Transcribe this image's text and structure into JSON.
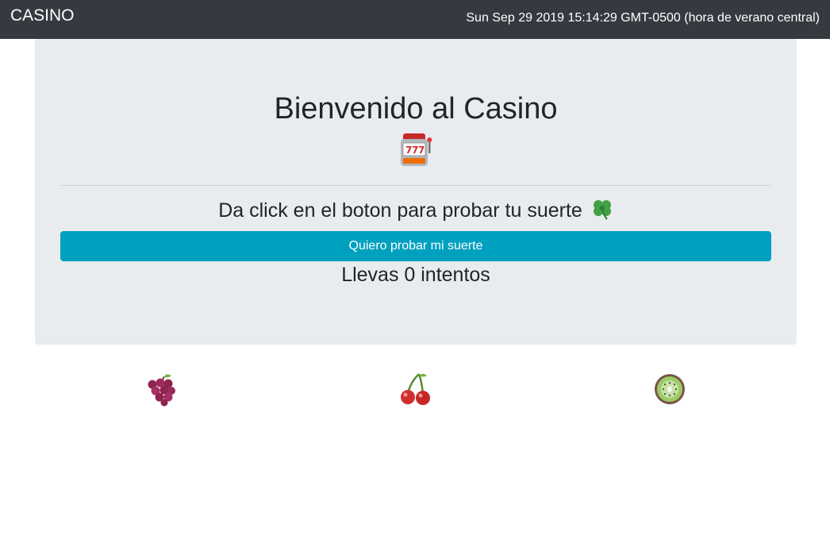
{
  "navbar": {
    "brand": "CASINO",
    "datetime": "Sun Sep 29 2019 15:14:29 GMT-0500 (hora de verano central)"
  },
  "jumbotron": {
    "title": "Bienvenido al Casino",
    "title_icon": "slot-machine-icon",
    "prompt": "Da click en el boton para probar tu suerte",
    "prompt_icon": "four-leaf-clover-icon",
    "button_label": "Quiero probar mi suerte",
    "attempts_text": "Llevas 0 intentos"
  },
  "reels": [
    {
      "icon": "grapes-icon"
    },
    {
      "icon": "cherries-icon"
    },
    {
      "icon": "kiwi-icon"
    }
  ],
  "colors": {
    "navbar_bg": "#343a40",
    "jumbotron_bg": "#e9ecef",
    "button_bg": "#00a0bf"
  }
}
